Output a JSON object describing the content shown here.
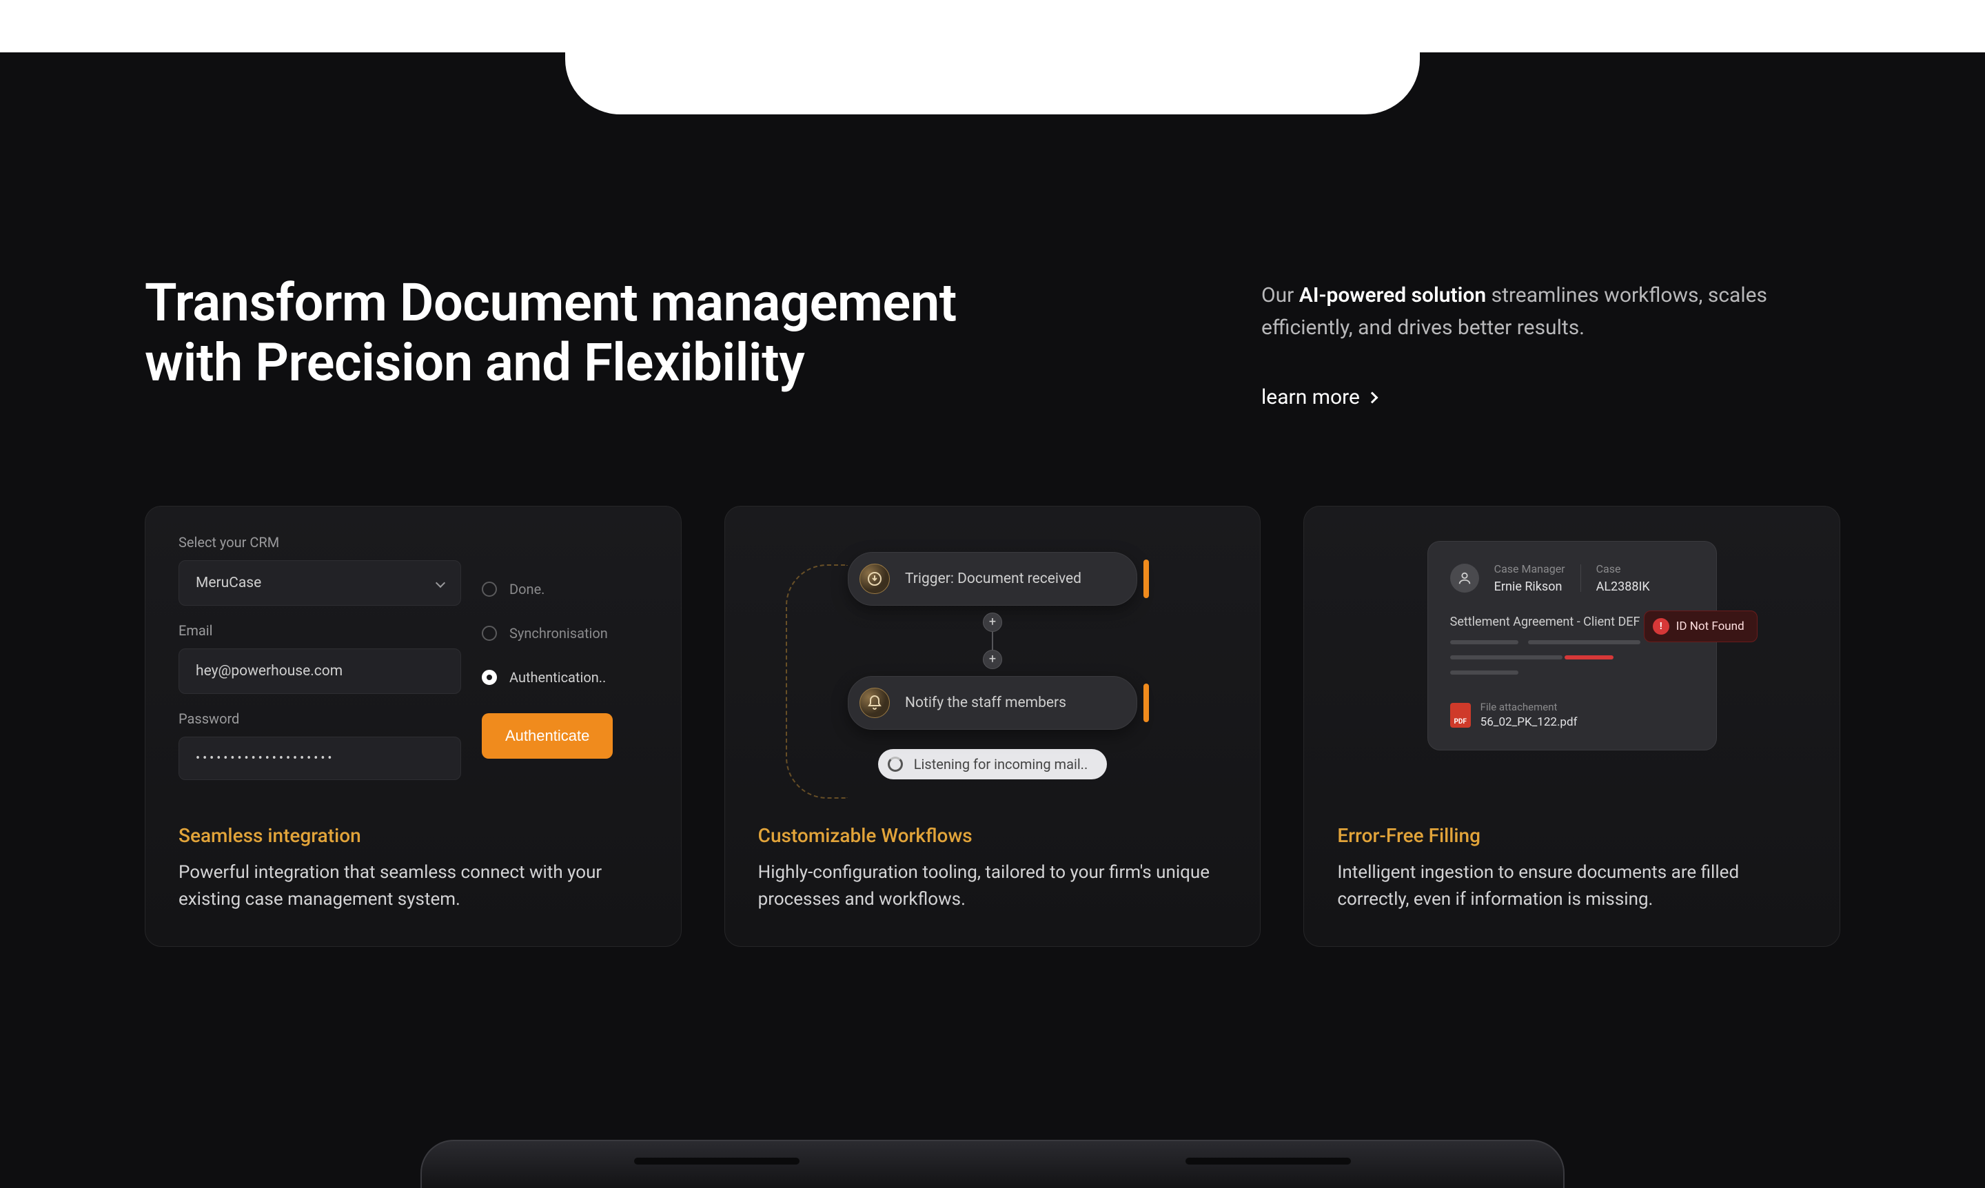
{
  "hero": {
    "title_line1": "Transform Document management",
    "title_line2": "with Precision and Flexibility",
    "subtext_prefix": "Our ",
    "subtext_strong": "AI-powered solution",
    "subtext_rest": " streamlines workflows, scales efficiently, and drives better results.",
    "learn_more": "learn more"
  },
  "card1": {
    "crm_label": "Select your CRM",
    "crm_value": "MeruCase",
    "email_label": "Email",
    "email_value": "hey@powerhouse.com",
    "pwd_label": "Password",
    "pwd_value": "••••••••••••••••••••",
    "status_done": "Done.",
    "status_sync": "Synchronisation",
    "status_auth": "Authentication..",
    "btn": "Authenticate",
    "title": "Seamless integration",
    "desc": "Powerful integration that seamless connect with your existing case management system."
  },
  "card2": {
    "trigger": "Trigger: Document received",
    "notify": "Notify the staff members",
    "listening": "Listening for incoming mail..",
    "title": "Customizable Workflows",
    "desc": "Highly-configuration tooling, tailored to your firm's unique processes and workflows."
  },
  "card3": {
    "cm_label": "Case Manager",
    "cm_value": "Ernie Rikson",
    "case_label": "Case",
    "case_value": "AL2388IK",
    "badge": "ID Not Found",
    "doc_title": "Settlement Agreement - Client DEF",
    "attach_label": "File attachement",
    "attach_name": "56_02_PK_122.pdf",
    "pdf_badge": "PDF",
    "title": "Error-Free Filling",
    "desc": "Intelligent ingestion to ensure documents are filled correctly, even if information is missing."
  }
}
